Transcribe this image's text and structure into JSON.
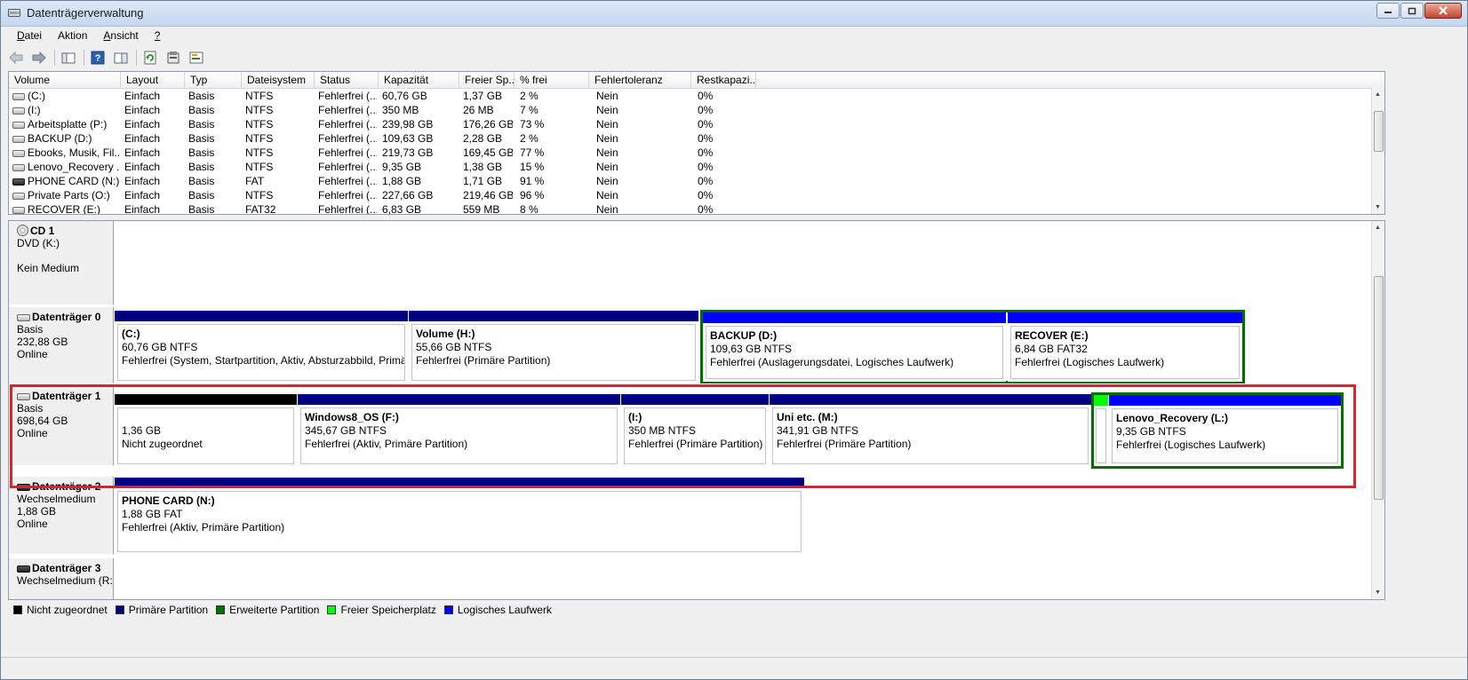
{
  "window": {
    "title": "Datenträgerverwaltung"
  },
  "menu": [
    {
      "key": "D",
      "rest": "atei"
    },
    {
      "key": "A",
      "rest": "ktion",
      "pre": "A"
    },
    {
      "key": "A",
      "rest": "nsicht"
    },
    {
      "key": "?",
      "rest": ""
    }
  ],
  "menu_labels": {
    "m0a": "D",
    "m0b": "atei",
    "m1a": "Ak",
    "m1b": "tion",
    "m2a": "A",
    "m2b": "nsicht",
    "m3a": "?",
    "m3b": ""
  },
  "toolbar_icons": [
    "back-arrow-icon",
    "forward-arrow-icon",
    "console-tree-icon",
    "help-icon",
    "details-pane-icon",
    "refresh-icon",
    "properties-icon",
    "settings-icon"
  ],
  "volume_list": {
    "columns": [
      "Volume",
      "Layout",
      "Typ",
      "Dateisystem",
      "Status",
      "Kapazität",
      "Freier Sp...",
      "% frei",
      "Fehlertoleranz",
      "Restkapazi..."
    ],
    "rows": [
      {
        "icon": "drive",
        "volume": "(C:)",
        "layout": "Einfach",
        "typ": "Basis",
        "fs": "NTFS",
        "status": "Fehlerfrei (...",
        "cap": "60,76 GB",
        "free": "1,37 GB",
        "pct": "2 %",
        "ft": "Nein",
        "rest": "0%"
      },
      {
        "icon": "drive",
        "volume": "(I:)",
        "layout": "Einfach",
        "typ": "Basis",
        "fs": "NTFS",
        "status": "Fehlerfrei (...",
        "cap": "350 MB",
        "free": "26 MB",
        "pct": "7 %",
        "ft": "Nein",
        "rest": "0%"
      },
      {
        "icon": "drive",
        "volume": "Arbeitsplatte (P:)",
        "layout": "Einfach",
        "typ": "Basis",
        "fs": "NTFS",
        "status": "Fehlerfrei (...",
        "cap": "239,98 GB",
        "free": "176,26 GB",
        "pct": "73 %",
        "ft": "Nein",
        "rest": "0%"
      },
      {
        "icon": "drive",
        "volume": "BACKUP (D:)",
        "layout": "Einfach",
        "typ": "Basis",
        "fs": "NTFS",
        "status": "Fehlerfrei (...",
        "cap": "109,63 GB",
        "free": "2,28 GB",
        "pct": "2 %",
        "ft": "Nein",
        "rest": "0%"
      },
      {
        "icon": "drive",
        "volume": "Ebooks, Musik, Fil...",
        "layout": "Einfach",
        "typ": "Basis",
        "fs": "NTFS",
        "status": "Fehlerfrei (...",
        "cap": "219,73 GB",
        "free": "169,45 GB",
        "pct": "77 %",
        "ft": "Nein",
        "rest": "0%"
      },
      {
        "icon": "drive",
        "volume": "Lenovo_Recovery ...",
        "layout": "Einfach",
        "typ": "Basis",
        "fs": "NTFS",
        "status": "Fehlerfrei (...",
        "cap": "9,35 GB",
        "free": "1,38 GB",
        "pct": "15 %",
        "ft": "Nein",
        "rest": "0%"
      },
      {
        "icon": "dark",
        "volume": "PHONE CARD (N:)",
        "layout": "Einfach",
        "typ": "Basis",
        "fs": "FAT",
        "status": "Fehlerfrei (...",
        "cap": "1,88 GB",
        "free": "1,71 GB",
        "pct": "91 %",
        "ft": "Nein",
        "rest": "0%"
      },
      {
        "icon": "drive",
        "volume": "Private Parts (O:)",
        "layout": "Einfach",
        "typ": "Basis",
        "fs": "NTFS",
        "status": "Fehlerfrei (...",
        "cap": "227,66 GB",
        "free": "219,46 GB",
        "pct": "96 %",
        "ft": "Nein",
        "rest": "0%"
      },
      {
        "icon": "drive",
        "volume": "RECOVER (E:)",
        "layout": "Einfach",
        "typ": "Basis",
        "fs": "FAT32",
        "status": "Fehlerfrei (...",
        "cap": "6,83 GB",
        "free": "559 MB",
        "pct": "8 %",
        "ft": "Nein",
        "rest": "0%"
      }
    ]
  },
  "disks": [
    {
      "name": "CD 1",
      "lines": [
        "DVD (K:)",
        "",
        "Kein Medium"
      ],
      "icon": "cd"
    },
    {
      "name": "Datenträger 0",
      "lines": [
        "Basis",
        "232,88 GB",
        "Online"
      ],
      "icon": "disk",
      "partitions": [
        {
          "bar": "primary",
          "name": "(C:)",
          "size": "60,76 GB NTFS",
          "status": "Fehlerfrei (System, Startpartition, Aktiv, Absturzabbild, Primäre"
        },
        {
          "bar": "primary",
          "name": "Volume  (H:)",
          "size": "55,66 GB NTFS",
          "status": "Fehlerfrei (Primäre Partition)"
        },
        {
          "bar": "logical",
          "name": "BACKUP  (D:)",
          "size": "109,63 GB NTFS",
          "status": "Fehlerfrei (Auslagerungsdatei, Logisches Laufwerk)"
        },
        {
          "bar": "logical",
          "name": "RECOVER  (E:)",
          "size": "6,84 GB FAT32",
          "status": "Fehlerfrei (Logisches Laufwerk)"
        }
      ]
    },
    {
      "name": "Datenträger 1",
      "lines": [
        "Basis",
        "698,64 GB",
        "Online"
      ],
      "icon": "disk",
      "partitions": [
        {
          "bar": "unallocated",
          "name": "",
          "size": "1,36 GB",
          "status": "Nicht zugeordnet"
        },
        {
          "bar": "primary",
          "name": "Windows8_OS  (F:)",
          "size": "345,67 GB NTFS",
          "status": "Fehlerfrei (Aktiv, Primäre Partition)"
        },
        {
          "bar": "primary",
          "name": "(I:)",
          "size": "350 MB NTFS",
          "status": "Fehlerfrei (Primäre Partition)"
        },
        {
          "bar": "primary",
          "name": "Uni etc.  (M:)",
          "size": "341,91 GB NTFS",
          "status": "Fehlerfrei (Primäre Partition)"
        },
        {
          "bar": "free",
          "name": "",
          "size": "",
          "status": ""
        },
        {
          "bar": "logical",
          "name": "Lenovo_Recovery  (L:)",
          "size": "9,35 GB NTFS",
          "status": "Fehlerfrei (Logisches Laufwerk)"
        }
      ]
    },
    {
      "name": "Datenträger 2",
      "lines": [
        "Wechselmedium",
        "1,88 GB",
        "Online"
      ],
      "icon": "dark",
      "partitions": [
        {
          "bar": "primary",
          "name": "PHONE CARD  (N:)",
          "size": "1,88 GB FAT",
          "status": "Fehlerfrei (Aktiv, Primäre Partition)"
        }
      ]
    },
    {
      "name": "Datenträger 3",
      "lines": [
        "Wechselmedium (R:"
      ],
      "icon": "dark"
    }
  ],
  "legend": [
    {
      "color": "#000000",
      "label": "Nicht zugeordnet"
    },
    {
      "color": "#000080",
      "label": "Primäre Partition"
    },
    {
      "color": "#007000",
      "label": "Erweiterte Partition"
    },
    {
      "color": "#00ff00",
      "label": "Freier Speicherplatz"
    },
    {
      "color": "#0000ff",
      "label": "Logisches Laufwerk"
    }
  ],
  "colors": {
    "primary": "#000080",
    "logical": "#0000ff",
    "extended": "#007000",
    "free": "#00ff00",
    "unallocated": "#000000",
    "highlight": "#e61e25"
  }
}
